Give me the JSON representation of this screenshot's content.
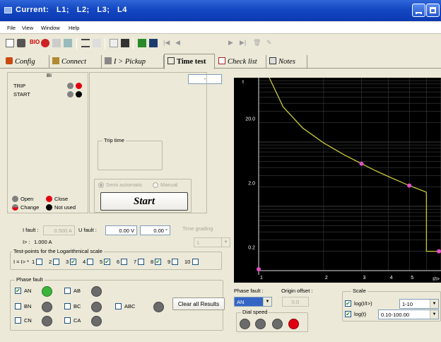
{
  "window": {
    "title": "Current:   L1;   L2;   L3;   L4"
  },
  "menu": [
    "File",
    "View",
    "Window",
    "Help"
  ],
  "toolbar": {
    "record_value": "-"
  },
  "tabs": [
    {
      "label": "Config",
      "icon": "config-icon"
    },
    {
      "label": "Connect",
      "icon": "connect-icon"
    },
    {
      "label": "I > Pickup",
      "icon": "pickup-icon"
    },
    {
      "label": "Time test",
      "icon": "time-test-icon",
      "active": true
    },
    {
      "label": "Check list",
      "icon": "checklist-icon"
    },
    {
      "label": "Notes",
      "icon": "notes-icon"
    }
  ],
  "bi": {
    "title": "BI",
    "rows": [
      {
        "label": "TRIP",
        "colors": [
          "#808080",
          "#e0000f"
        ]
      },
      {
        "label": "START",
        "colors": [
          "#808080",
          "#000000"
        ]
      }
    ]
  },
  "legend": {
    "open": "Open",
    "close": "Close",
    "change": "Change",
    "not_used": "Not used",
    "colors": {
      "open": "#808080",
      "close": "#e0000f",
      "change": "#a03030",
      "not_used": "#000000"
    }
  },
  "trip_time": {
    "title": "Trip time"
  },
  "mode": {
    "semi_automatic": "Semi automatic",
    "manual": "Manual",
    "selected": "Semi automatic"
  },
  "start_button": "Start",
  "fault": {
    "i_label": "I fault :",
    "i_value": "0.500 A",
    "u_label": "U fault :",
    "u_value": "0.00 V",
    "angle_value": "0.00 °",
    "ib_label": "I> :",
    "ib_value": "1.000 A",
    "time_grading_label": "Time grading",
    "time_grading_value": "1"
  },
  "testpoints": {
    "title": "Test-points for the Logarithmical scale",
    "prefix": "I = I> *",
    "items": [
      {
        "n": "1",
        "checked": false
      },
      {
        "n": "2",
        "checked": false
      },
      {
        "n": "3",
        "checked": true
      },
      {
        "n": "4",
        "checked": false
      },
      {
        "n": "5",
        "checked": true
      },
      {
        "n": "6",
        "checked": false
      },
      {
        "n": "7",
        "checked": false
      },
      {
        "n": "8",
        "checked": true
      },
      {
        "n": "9",
        "checked": false
      },
      {
        "n": "10",
        "checked": false
      }
    ]
  },
  "phase": {
    "title": "Phase fault",
    "items": [
      {
        "label": "AN",
        "checked": true,
        "color": "#3cb43c"
      },
      {
        "label": "BN",
        "checked": false,
        "color": "#6b6b6b"
      },
      {
        "label": "CN",
        "checked": false,
        "color": "#6b6b6b"
      },
      {
        "label": "AB",
        "checked": false,
        "color": "#6b6b6b"
      },
      {
        "label": "BC",
        "checked": false,
        "color": "#6b6b6b"
      },
      {
        "label": "CA",
        "checked": false,
        "color": "#6b6b6b"
      },
      {
        "label": "ABC",
        "checked": false,
        "color": "#6b6b6b"
      }
    ]
  },
  "clear_button": "Clear all Results",
  "phase_fault_sel": {
    "label": "Phase fault :",
    "value": "AN"
  },
  "origin": {
    "label": "Origin offset :",
    "value": "0.0"
  },
  "dial": {
    "label": "Dial speed",
    "colors": [
      "#6b6b6b",
      "#6b6b6b",
      "#6b6b6b",
      "#e0000f"
    ]
  },
  "scale": {
    "title": "Scale",
    "x_label": "log(I/I>)",
    "x_checked": true,
    "x_range": "1-10",
    "y_label": "log(t)",
    "y_checked": true,
    "y_range": "0.10-100.00"
  },
  "colors": {
    "plot_bg": "#000000",
    "curve": "#c8c83c",
    "points": "#e24fc8",
    "grid": "#3c3c3c",
    "text": "#ffffff"
  },
  "chart_data": {
    "type": "line",
    "xscale": "log",
    "yscale": "log",
    "xlim": [
      1,
      10
    ],
    "ylim": [
      0.1,
      100
    ],
    "x_ticks": [
      "1",
      "2",
      "3",
      "4",
      "5"
    ],
    "x_unit": "I/I>",
    "y_ticks": [
      "20.0",
      "2.0",
      "0.2"
    ],
    "y_top_label": "t",
    "series": [
      {
        "x": [
          1.12,
          1.3,
          1.6,
          2,
          2.5,
          3,
          3.5,
          4,
          4.5,
          5,
          5.5,
          6
        ],
        "y": [
          100,
          35,
          16.5,
          9.7,
          6.3,
          4.6,
          3.55,
          2.9,
          2.44,
          2.1,
          1.86,
          1.66
        ]
      },
      {
        "x": [
          6,
          6,
          10
        ],
        "y": [
          1.66,
          0.2,
          0.2
        ]
      }
    ],
    "markers": [
      {
        "x": 1,
        "y": 0.1
      },
      {
        "x": 3,
        "y": 4.6
      },
      {
        "x": 5,
        "y": 2.1
      },
      {
        "x": 8,
        "y": 0.2
      }
    ]
  }
}
